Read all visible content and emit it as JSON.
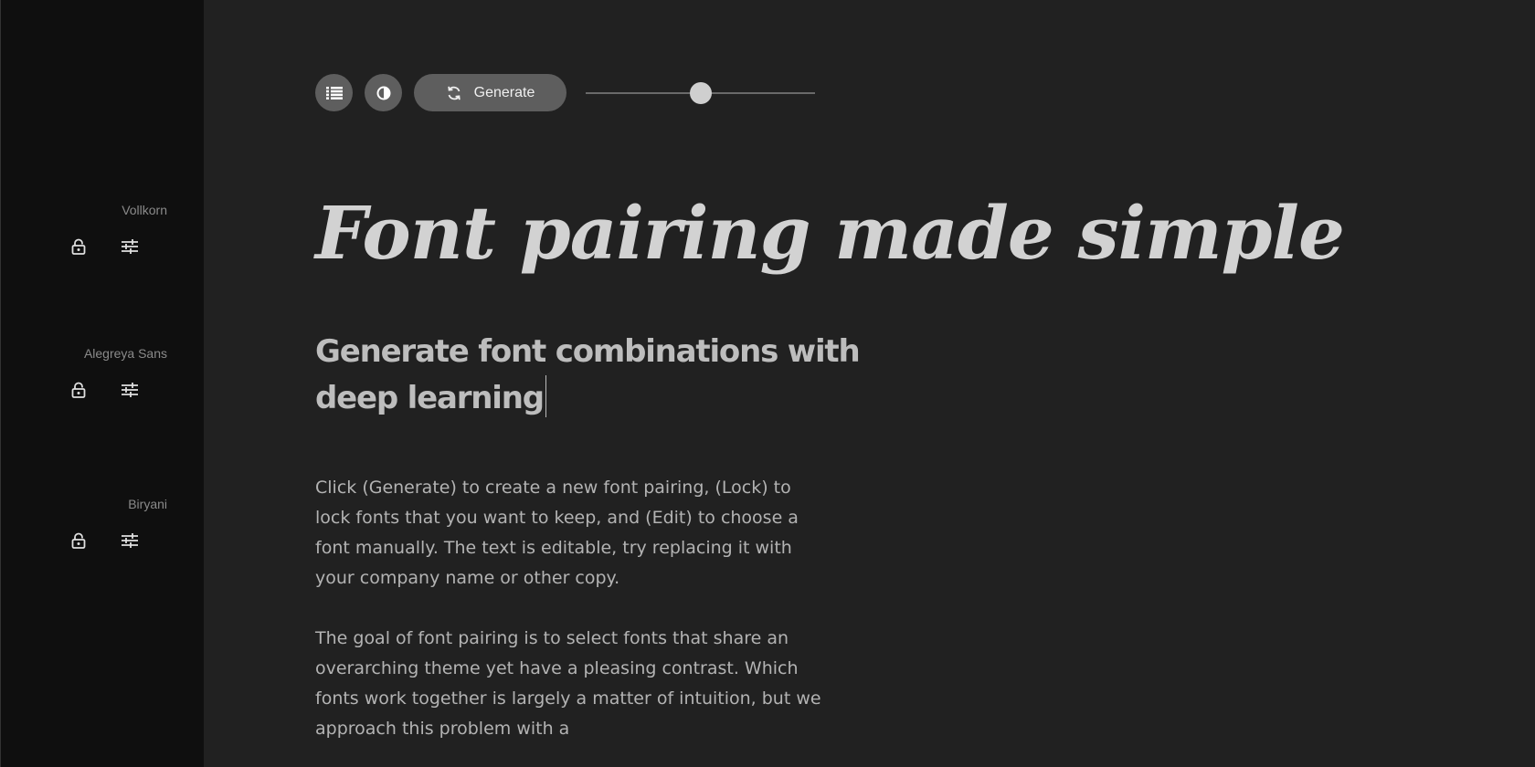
{
  "sidebar": {
    "fonts": [
      {
        "name": "Vollkorn",
        "lock_icon": "lock-icon",
        "edit_icon": "sliders-icon"
      },
      {
        "name": "Alegreya Sans",
        "lock_icon": "lock-icon",
        "edit_icon": "sliders-icon"
      },
      {
        "name": "Biryani",
        "lock_icon": "lock-icon",
        "edit_icon": "sliders-icon"
      }
    ]
  },
  "toolbar": {
    "list_icon": "list-icon",
    "contrast_icon": "contrast-icon",
    "generate_label": "Generate",
    "generate_icon": "refresh-icon",
    "slider_value": 0.5
  },
  "main": {
    "headline": "Font pairing made simple",
    "subheadline": "Generate font combinations with deep learning",
    "paragraphs": [
      "Click (Generate) to create a new font pairing, (Lock) to lock fonts that you want to keep, and (Edit) to choose a font manually. The text is editable, try replacing it with your company name or other copy.",
      "The goal of font pairing is to select fonts that share an overarching theme yet have a pleasing contrast. Which fonts work together is largely a matter of intuition, but we approach this problem with a"
    ]
  },
  "colors": {
    "background": "#212121",
    "sidebar": "#0f0f0f",
    "button": "#5e5e5e",
    "text": "#d2d2d2"
  }
}
